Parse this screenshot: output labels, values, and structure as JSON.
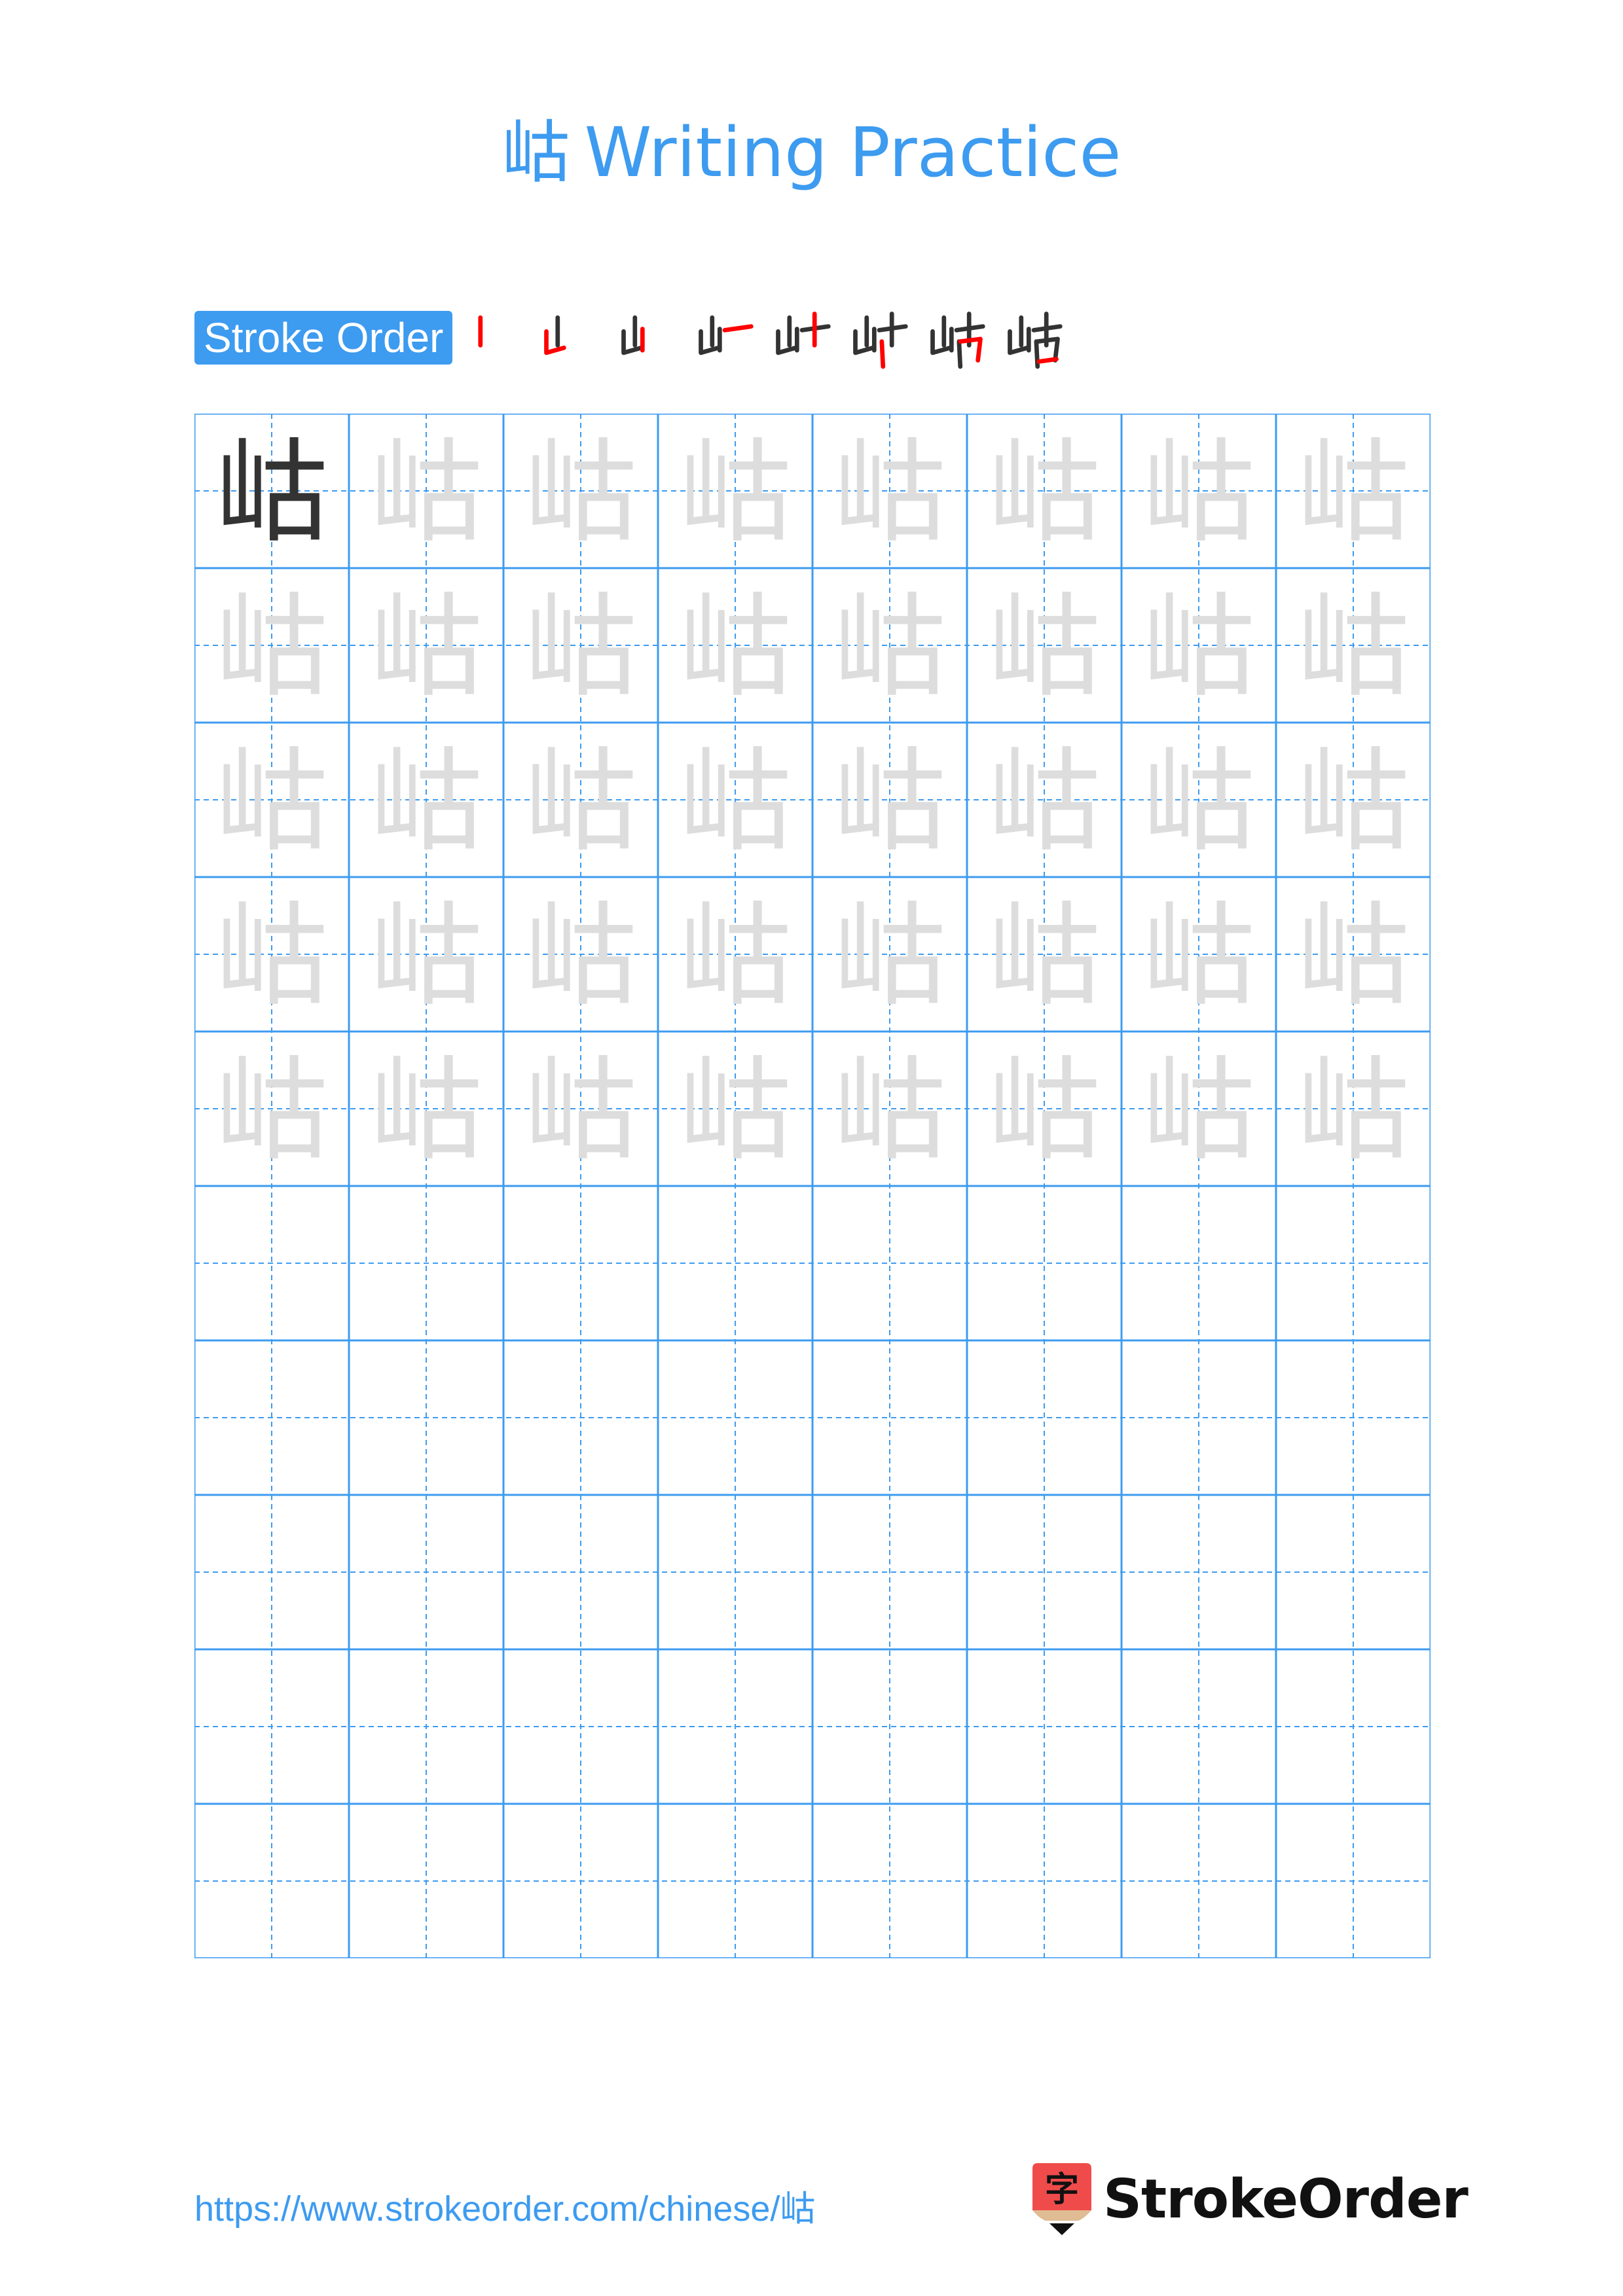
{
  "page": {
    "title_char": "岵",
    "title_text": "Writing Practice"
  },
  "stroke_order": {
    "label": "Stroke Order",
    "total_strokes": 8,
    "highlight_color": "#ff0000",
    "done_color": "#333333",
    "steps": [
      {
        "step": 1
      },
      {
        "step": 2
      },
      {
        "step": 3
      },
      {
        "step": 4
      },
      {
        "step": 5
      },
      {
        "step": 6
      },
      {
        "step": 7
      },
      {
        "step": 8
      }
    ]
  },
  "practice_grid": {
    "character": "岵",
    "columns": 8,
    "rows": 10,
    "model_cells": 1,
    "trace_rows": 5,
    "grid_color": "#3d9bf0",
    "model_color": "#333333",
    "trace_color": "#dddddd"
  },
  "footer": {
    "url": "https://www.strokeorder.com/chinese/岵",
    "brand": "StrokeOrder",
    "logo_glyph": "字",
    "logo_color": "#f04b4b"
  }
}
